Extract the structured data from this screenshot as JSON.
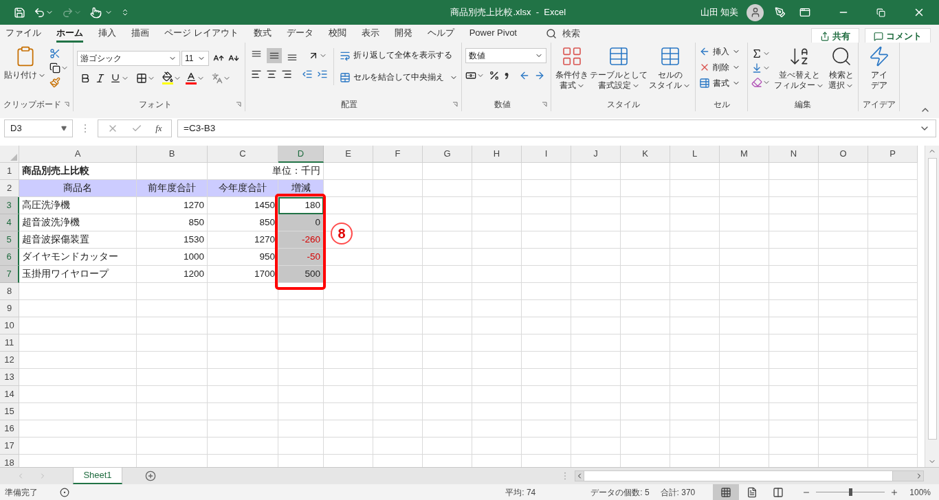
{
  "title_bar": {
    "title": "商品別売上比較.xlsx  -  Excel",
    "user": "山田 知美",
    "redo_disabled": true
  },
  "ribbon_tabs": [
    {
      "label": "ファイル",
      "selected": false
    },
    {
      "label": "ホーム",
      "selected": true
    },
    {
      "label": "挿入",
      "selected": false
    },
    {
      "label": "描画",
      "selected": false
    },
    {
      "label": "ページ レイアウト",
      "selected": false
    },
    {
      "label": "数式",
      "selected": false
    },
    {
      "label": "データ",
      "selected": false
    },
    {
      "label": "校閲",
      "selected": false
    },
    {
      "label": "表示",
      "selected": false
    },
    {
      "label": "開発",
      "selected": false
    },
    {
      "label": "ヘルプ",
      "selected": false
    },
    {
      "label": "Power Pivot",
      "selected": false
    }
  ],
  "search": {
    "placeholder": "検索"
  },
  "share_button": "共有",
  "comment_button": "コメント",
  "clipboard": {
    "paste": [
      "貼り付け"
    ],
    "label": "クリップボード"
  },
  "font": {
    "font_name": "游ゴシック",
    "font_size": "11",
    "label": "フォント"
  },
  "alignment": {
    "vertical": [
      {
        "selected": false
      },
      {
        "selected": true
      },
      {
        "selected": false
      }
    ],
    "wrap": "折り返して全体を表示する",
    "merge": "セルを結合して中央揃え",
    "label": "配置"
  },
  "number": {
    "format": "数値",
    "label": "数値"
  },
  "styles": {
    "buttons": [
      {
        "kind": "conditional",
        "lines": [
          "条件付き",
          "書式"
        ]
      },
      {
        "kind": "table",
        "lines": [
          "テーブルとして",
          "書式設定"
        ]
      },
      {
        "kind": "cell",
        "lines": [
          "セルの",
          "スタイル"
        ]
      }
    ],
    "label": "スタイル"
  },
  "cells": {
    "items": [
      {
        "kind": "insert",
        "label": "挿入"
      },
      {
        "kind": "delete",
        "label": "削除"
      },
      {
        "kind": "format",
        "label": "書式"
      }
    ],
    "label": "セル"
  },
  "editing": {
    "sort": [
      "並べ替えと",
      "フィルター"
    ],
    "find": [
      "検索と",
      "選択"
    ],
    "label": "編集"
  },
  "ideas": {
    "button": [
      "アイ",
      "デア"
    ],
    "label": "アイデア"
  },
  "formula_bar": {
    "name_box": "D3",
    "function_button": "fx",
    "formula": "=C3-B3"
  },
  "sheet": {
    "columns": [
      {
        "label": "A",
        "selected": false
      },
      {
        "label": "B",
        "selected": false
      },
      {
        "label": "C",
        "selected": false
      },
      {
        "label": "D",
        "selected": true
      },
      {
        "label": "E",
        "selected": false
      },
      {
        "label": "F",
        "selected": false
      },
      {
        "label": "G",
        "selected": false
      },
      {
        "label": "H",
        "selected": false
      },
      {
        "label": "I",
        "selected": false
      },
      {
        "label": "J",
        "selected": false
      },
      {
        "label": "K",
        "selected": false
      },
      {
        "label": "L",
        "selected": false
      },
      {
        "label": "M",
        "selected": false
      },
      {
        "label": "N",
        "selected": false
      },
      {
        "label": "O",
        "selected": false
      },
      {
        "label": "P",
        "selected": false
      }
    ],
    "row_numbers": [
      {
        "label": "1",
        "selected": false
      },
      {
        "label": "2",
        "selected": false
      },
      {
        "label": "3",
        "selected": true
      },
      {
        "label": "4",
        "selected": true
      },
      {
        "label": "5",
        "selected": true
      },
      {
        "label": "6",
        "selected": true
      },
      {
        "label": "7",
        "selected": true
      },
      {
        "label": "8",
        "selected": false
      },
      {
        "label": "9",
        "selected": false
      },
      {
        "label": "10",
        "selected": false
      },
      {
        "label": "11",
        "selected": false
      },
      {
        "label": "12",
        "selected": false
      },
      {
        "label": "13",
        "selected": false
      },
      {
        "label": "14",
        "selected": false
      },
      {
        "label": "15",
        "selected": false
      },
      {
        "label": "16",
        "selected": false
      },
      {
        "label": "17",
        "selected": false
      },
      {
        "label": "18",
        "selected": false
      }
    ],
    "title": "商品別売上比較",
    "unit": "単位：千円",
    "headers": [
      "商品名",
      "前年度合計",
      "今年度合計",
      "増減"
    ],
    "rows": [
      {
        "product": "高圧洗浄機",
        "previous": "1270",
        "current": "1450",
        "change": "180",
        "negative": false,
        "selected": true,
        "active": true
      },
      {
        "product": "超音波洗浄機",
        "previous": "850",
        "current": "850",
        "change": "0",
        "negative": false,
        "selected": true,
        "active": false
      },
      {
        "product": "超音波探傷装置",
        "previous": "1530",
        "current": "1270",
        "change": "-260",
        "negative": true,
        "selected": true,
        "active": false
      },
      {
        "product": "ダイヤモンドカッター",
        "previous": "1000",
        "current": "950",
        "change": "-50",
        "negative": true,
        "selected": true,
        "active": false
      },
      {
        "product": "玉掛用ワイヤロープ",
        "previous": "1200",
        "current": "1700",
        "change": "500",
        "negative": false,
        "selected": true,
        "active": false
      }
    ]
  },
  "annotation": {
    "label": "8"
  },
  "sheet_tabs": [
    {
      "label": "Sheet1",
      "selected": true
    }
  ],
  "status_bar": {
    "ready": "準備完了",
    "average": "平均: 74",
    "count": "データの個数: 5",
    "sum": "合計: 370",
    "views": [
      {
        "kind": "normal",
        "selected": true
      },
      {
        "kind": "page",
        "selected": false
      },
      {
        "kind": "break",
        "selected": false
      }
    ],
    "zoom": {
      "level": 0.5
    },
    "zoom_text": "100%"
  }
}
